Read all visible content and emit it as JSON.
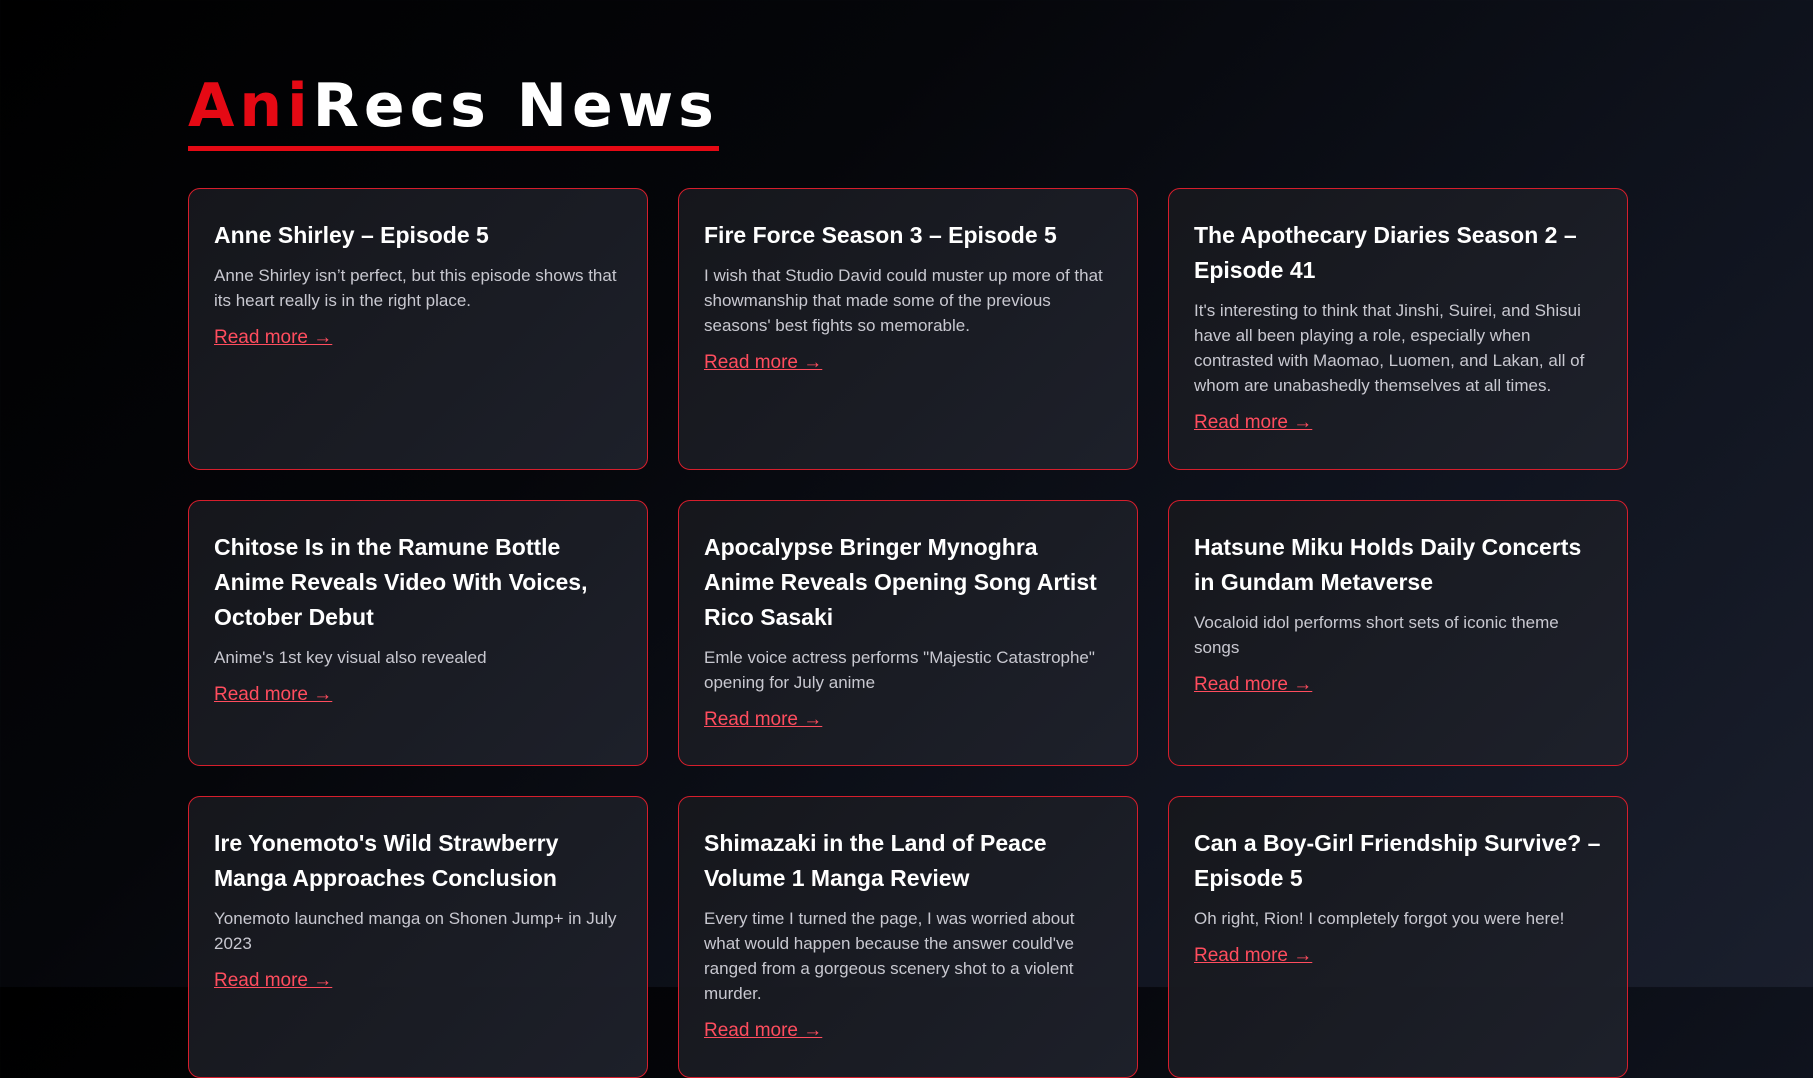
{
  "site": {
    "logo_accent": "Ani",
    "logo_rest": "Recs News",
    "accent_color": "#e50914"
  },
  "articles": [
    {
      "title": "Anne Shirley – Episode 5",
      "summary": "Anne Shirley isn’t perfect, but this episode shows that its heart really is in the right place.",
      "link_label": "Read more →"
    },
    {
      "title": "Fire Force Season 3 – Episode 5",
      "summary": "I wish that Studio David could muster up more of that showmanship that made some of the previous seasons' best fights so memorable.",
      "link_label": "Read more →"
    },
    {
      "title": "The Apothecary Diaries Season 2 – Episode 41",
      "summary": "It's interesting to think that Jinshi, Suirei, and Shisui have all been playing a role, especially when contrasted with Maomao, Luomen, and Lakan, all of whom are unabashedly themselves at all times.",
      "link_label": "Read more →"
    },
    {
      "title": "Chitose Is in the Ramune Bottle Anime Reveals Video With Voices, October Debut",
      "summary": "Anime's 1st key visual also revealed",
      "link_label": "Read more →"
    },
    {
      "title": "Apocalypse Bringer Mynoghra Anime Reveals Opening Song Artist Rico Sasaki",
      "summary": "Emle voice actress performs \"Majestic Catastrophe\" opening for July anime",
      "link_label": "Read more →"
    },
    {
      "title": "Hatsune Miku Holds Daily Concerts in Gundam Metaverse",
      "summary": "Vocaloid idol performs short sets of iconic theme songs",
      "link_label": "Read more →"
    },
    {
      "title": "Ire Yonemoto's Wild Strawberry Manga Approaches Conclusion",
      "summary": "Yonemoto launched manga on Shonen Jump+ in July 2023",
      "link_label": "Read more →"
    },
    {
      "title": "Shimazaki in the Land of Peace Volume 1 Manga Review",
      "summary": "Every time I turned the page, I was worried about what would happen because the answer could've ranged from a gorgeous scenery shot to a violent murder.",
      "link_label": "Read more →"
    },
    {
      "title": "Can a Boy-Girl Friendship Survive? – Episode 5",
      "summary": "Oh right, Rion! I completely forgot you were here!",
      "link_label": "Read more →"
    }
  ]
}
